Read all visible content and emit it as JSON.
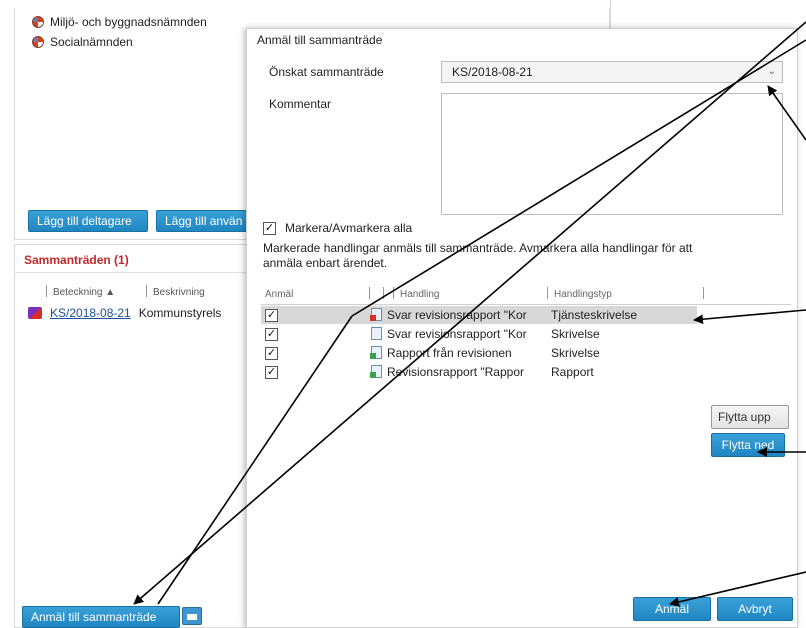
{
  "background": {
    "tree_items": [
      {
        "label": "Miljö- och byggnadsnämnden",
        "icon": "committee-icon"
      },
      {
        "label": "Socialnämnden",
        "icon": "committee-icon"
      }
    ],
    "buttons": {
      "add_participant": "Lägg till deltagare",
      "add_user": "Lägg till använ"
    },
    "section_title": "Sammanträden (1)",
    "columns": {
      "designation": "Beteckning ▲",
      "description": "Beskrivning"
    },
    "meeting_row": {
      "designation": "KS/2018-08-21",
      "description": "Kommunstyrels"
    },
    "report_button": "Anmäl till sammanträde"
  },
  "dialog": {
    "title": "Anmäl till sammanträde",
    "meeting_label": "Önskat sammanträde",
    "meeting_value": "KS/2018-08-21",
    "comment_label": "Kommentar",
    "comment_value": "",
    "select_all_label": "Markera/Avmarkera alla",
    "select_all_checked": true,
    "info_text": "Markerade handlingar anmäls till sammanträde. Avmarkera alla handlingar för att anmäla enbart ärendet.",
    "grid": {
      "columns": {
        "report": "Anmäl",
        "document": "Handling",
        "doc_type": "Handlingstyp"
      },
      "rows": [
        {
          "checked": true,
          "check_mark": "✓",
          "icon": "red",
          "document": "Svar revisionsrapport \"Kor",
          "doc_type": "Tjänsteskrivelse",
          "selected": true
        },
        {
          "checked": true,
          "check_mark": "✓",
          "icon": "blue",
          "document": "Svar revisionsrapport \"Kor",
          "doc_type": "Skrivelse",
          "selected": false
        },
        {
          "checked": true,
          "check_mark": "✓",
          "icon": "green",
          "document": "Rapport från revisionen",
          "doc_type": "Skrivelse",
          "selected": false
        },
        {
          "checked": true,
          "check_mark": "✓",
          "icon": "green",
          "document": "Revisionsrapport \"Rappor",
          "doc_type": "Rapport",
          "selected": false
        }
      ]
    },
    "move_up": "Flytta upp",
    "move_down": "Flytta ned",
    "submit": "Anmäl",
    "cancel": "Avbryt"
  },
  "colors": {
    "accent_blue": "#1f86c2",
    "section_red": "#c0282b",
    "link_blue": "#1a4f9c"
  }
}
